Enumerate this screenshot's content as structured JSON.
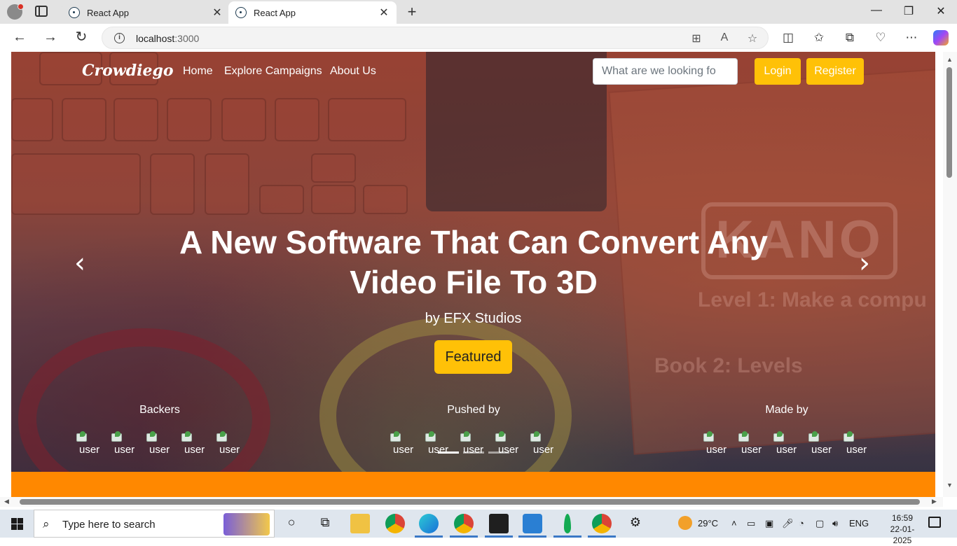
{
  "browser": {
    "tabs": [
      {
        "title": "React App",
        "active": false
      },
      {
        "title": "React App",
        "active": true
      }
    ],
    "tab_close_glyph": "✕",
    "new_tab_glyph": "+",
    "url_host": "localhost",
    "url_port": ":3000",
    "window_controls": {
      "minimize": "—",
      "maximize": "❐",
      "close": "✕"
    },
    "nav": {
      "back": "←",
      "forward": "→",
      "reload": "↻"
    },
    "icons": [
      "apps-icon",
      "read-aloud-icon",
      "favorite-star-icon",
      "split-screen-icon",
      "favorites-icon",
      "collections-icon",
      "performance-icon",
      "more-icon",
      "copilot-icon"
    ]
  },
  "site": {
    "brand": "Crowdiego",
    "nav_links": [
      "Home",
      "Explore Campaigns",
      "About Us"
    ],
    "search_placeholder": "What are we looking fo",
    "login_label": "Login",
    "register_label": "Register",
    "hero": {
      "headline_line1": "A New Software That Can Convert Any",
      "headline_line2": "Video File To 3D",
      "byline": "by EFX Studios",
      "badge": "Featured",
      "prev_glyph": "‹",
      "next_glyph": "›",
      "background_words": {
        "kano": "KANO",
        "book_line1": "Level 1: Make a compu",
        "book_line2": "Book 2: Levels"
      },
      "groups": [
        {
          "title": "Backers",
          "avatars": [
            "user",
            "user",
            "user",
            "user",
            "user"
          ]
        },
        {
          "title": "Pushed by",
          "avatars": [
            "user",
            "user",
            "user",
            "user",
            "user"
          ]
        },
        {
          "title": "Made by",
          "avatars": [
            "user",
            "user",
            "user",
            "user",
            "user"
          ]
        }
      ],
      "carousel_active_index": 0,
      "carousel_count": 3
    },
    "accent_color": "#ffc107",
    "band_color": "#ff8800"
  },
  "taskbar": {
    "search_placeholder": "Type here to search",
    "apps": [
      "task-view-icon",
      "widgets-icon",
      "file-explorer-icon",
      "chrome-icon",
      "edge-icon",
      "chrome-profile-a-icon",
      "terminal-icon",
      "vscode-icon",
      "mongodb-icon",
      "chrome-profile-d-icon",
      "settings-icon"
    ],
    "temperature": "29°C",
    "language": "ENG",
    "time": "16:59",
    "date": "22-01-2025"
  }
}
